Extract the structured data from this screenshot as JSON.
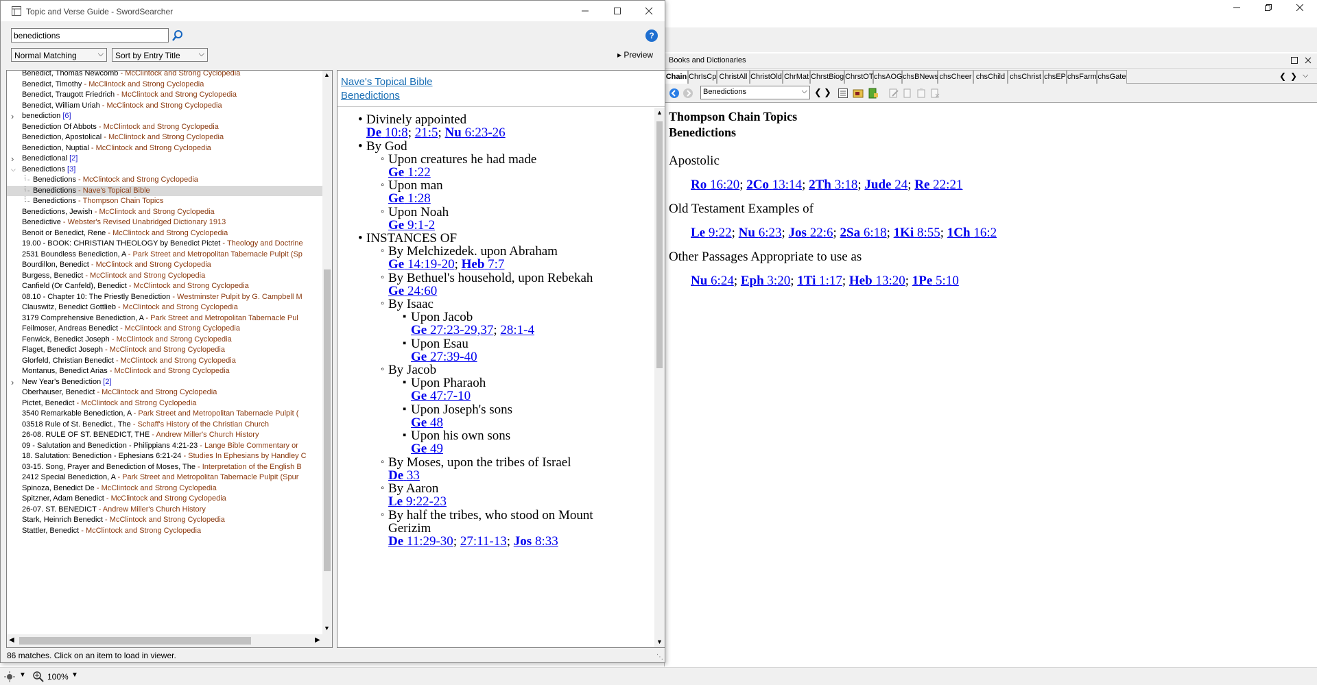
{
  "main_window": {
    "minimize_label": "Minimize",
    "maximize_label": "Restore",
    "close_label": "Close"
  },
  "books": {
    "title": "Books and Dictionaries",
    "tabs": [
      "Chain",
      "ChrIsCp",
      "ChristAll",
      "ChristOld",
      "ChrMat",
      "ChrstBiog",
      "ChrstOT",
      "chsAOG",
      "chsBNews",
      "chsCheer",
      "chsChild",
      "chsChrist",
      "chsEP",
      "chsFarm",
      "chsGate"
    ],
    "active_tab": "Chain",
    "topic_select": "Benedictions",
    "heading1": "Thompson Chain Topics",
    "heading2": "Benedictions",
    "sections": [
      {
        "label": "Apostolic",
        "refs": [
          {
            "b": "Ro",
            "r": "16:20"
          },
          {
            "b": "2Co",
            "r": "13:14"
          },
          {
            "b": "2Th",
            "r": "3:18"
          },
          {
            "b": "Jude",
            "r": "24"
          },
          {
            "b": "Re",
            "r": "22:21"
          }
        ]
      },
      {
        "label": "Old Testament Examples of",
        "refs": [
          {
            "b": "Le",
            "r": "9:22"
          },
          {
            "b": "Nu",
            "r": "6:23"
          },
          {
            "b": "Jos",
            "r": "22:6"
          },
          {
            "b": "2Sa",
            "r": "6:18"
          },
          {
            "b": "1Ki",
            "r": "8:55"
          },
          {
            "b": "1Ch",
            "r": "16:2"
          }
        ]
      },
      {
        "label": "Other Passages Appropriate to use as",
        "refs": [
          {
            "b": "Nu",
            "r": "6:24"
          },
          {
            "b": "Eph",
            "r": "3:20"
          },
          {
            "b": "1Ti",
            "r": "1:17"
          },
          {
            "b": "Heb",
            "r": "13:20"
          },
          {
            "b": "1Pe",
            "r": "5:10"
          }
        ]
      }
    ]
  },
  "dialog": {
    "title": "Topic and Verse Guide - SwordSearcher",
    "search_value": "benedictions",
    "match_mode": "Normal Matching",
    "sort_mode": "Sort by Entry Title",
    "preview_label": "▸ Preview",
    "help_label": "?",
    "status": "86 matches. Click on an item to load in viewer."
  },
  "list": [
    {
      "t": "Benedict, Thomas Newcomb",
      "s": " - McClintock and Strong Cyclopedia",
      "ind": 1
    },
    {
      "t": "Benedict, Timothy",
      "s": " - McClintock and Strong Cyclopedia",
      "ind": 1
    },
    {
      "t": "Benedict, Traugott Friedrich",
      "s": " - McClintock and Strong Cyclopedia",
      "ind": 1
    },
    {
      "t": "Benedict, William Uriah",
      "s": " - McClintock and Strong Cyclopedia",
      "ind": 1
    },
    {
      "t": "benediction",
      "c": " [6]",
      "ind": 1,
      "exp": "closed"
    },
    {
      "t": "Benediction Of Abbots",
      "s": " - McClintock and Strong Cyclopedia",
      "ind": 1
    },
    {
      "t": "Benediction, Apostolical",
      "s": " - McClintock and Strong Cyclopedia",
      "ind": 1
    },
    {
      "t": "Benediction, Nuptial",
      "s": " - McClintock and Strong Cyclopedia",
      "ind": 1
    },
    {
      "t": "Benedictional",
      "c": " [2]",
      "ind": 1,
      "exp": "closed"
    },
    {
      "t": "Benedictions",
      "c": " [3]",
      "ind": 1,
      "exp": "open"
    },
    {
      "t": "Benedictions",
      "s": " - McClintock and Strong Cyclopedia",
      "ind": 2
    },
    {
      "t": "Benedictions",
      "s": " - Nave's Topical Bible",
      "ind": 2,
      "sel": true
    },
    {
      "t": "Benedictions",
      "s": " - Thompson Chain Topics",
      "ind": 2
    },
    {
      "t": "Benedictions, Jewish",
      "s": " - McClintock and Strong Cyclopedia",
      "ind": 1
    },
    {
      "t": "Benedictive",
      "s": " - Webster's Revised Unabridged Dictionary 1913",
      "ind": 1
    },
    {
      "t": "Benoit or Benedict, Rene",
      "s": " - McClintock and Strong Cyclopedia",
      "ind": 1
    },
    {
      "t": "19.00 - BOOK: CHRISTIAN THEOLOGY by Benedict Pictet",
      "s": " - Theology and Doctrine",
      "ind": 1
    },
    {
      "t": "2531 Boundless Benediction, A",
      "s": " - Park Street and Metropolitan Tabernacle Pulpit (Sp",
      "ind": 1
    },
    {
      "t": "Bourdillon, Benedict",
      "s": " - McClintock and Strong Cyclopedia",
      "ind": 1
    },
    {
      "t": "Burgess, Benedict",
      "s": " - McClintock and Strong Cyclopedia",
      "ind": 1
    },
    {
      "t": "Canfield (Or Canfeld), Benedict",
      "s": " - McClintock and Strong Cyclopedia",
      "ind": 1
    },
    {
      "t": "08.10 - Chapter 10: The Priestly Benediction",
      "s": " - Westminster Pulpit by  G. Campbell M",
      "ind": 1
    },
    {
      "t": "Clauswitz, Benedict Gottlieb",
      "s": " - McClintock and Strong Cyclopedia",
      "ind": 1
    },
    {
      "t": "3179 Comprehensive Benediction, A",
      "s": " - Park Street and Metropolitan Tabernacle Pul",
      "ind": 1
    },
    {
      "t": "Feilmoser, Andreas Benedict",
      "s": " - McClintock and Strong Cyclopedia",
      "ind": 1
    },
    {
      "t": "Fenwick, Benedict Joseph",
      "s": " - McClintock and Strong Cyclopedia",
      "ind": 1
    },
    {
      "t": "Flaget, Benedict Joseph",
      "s": " - McClintock and Strong Cyclopedia",
      "ind": 1
    },
    {
      "t": "Glorfeld, Christian Benedict",
      "s": " - McClintock and Strong Cyclopedia",
      "ind": 1
    },
    {
      "t": "Montanus, Benedict Arias",
      "s": " - McClintock and Strong Cyclopedia",
      "ind": 1
    },
    {
      "t": "New Year's Benediction",
      "c": " [2]",
      "ind": 1,
      "exp": "closed"
    },
    {
      "t": "Oberhauser, Benedict",
      "s": " - McClintock and Strong Cyclopedia",
      "ind": 1
    },
    {
      "t": "Pictet, Benedict",
      "s": " - McClintock and Strong Cyclopedia",
      "ind": 1
    },
    {
      "t": "3540 Remarkable Benediction, A",
      "s": " - Park Street and Metropolitan Tabernacle Pulpit (",
      "ind": 1
    },
    {
      "t": "03518  Rule of St.  Benedict., The",
      "s": " - Schaff's History of the Christian Church",
      "ind": 1
    },
    {
      "t": "26-08. RULE OF ST. BENEDICT, THE",
      "s": " - Andrew Miller's Church History",
      "ind": 1
    },
    {
      "t": "09 - Salutation and Benediction - Philippians 4:21-23",
      "s": " - Lange Bible Commentary or",
      "ind": 1
    },
    {
      "t": "18. Salutation: Benediction - Ephesians 6:21-24",
      "s": " - Studies In Ephesians by Handley C",
      "ind": 1
    },
    {
      "t": "03-15. Song, Prayer and Benediction of Moses, The",
      "s": " - Interpretation of the English B",
      "ind": 1
    },
    {
      "t": "2412 Special Benediction, A",
      "s": " - Park Street and Metropolitan Tabernacle Pulpit (Spur",
      "ind": 1
    },
    {
      "t": "Spinoza, Benedict De",
      "s": " - McClintock and Strong Cyclopedia",
      "ind": 1
    },
    {
      "t": "Spitzner, Adam Benedict",
      "s": " - McClintock and Strong Cyclopedia",
      "ind": 1
    },
    {
      "t": "26-07. ST. BENEDICT",
      "s": " - Andrew Miller's Church History",
      "ind": 1
    },
    {
      "t": "Stark, Heinrich Benedict",
      "s": " - McClintock and Strong Cyclopedia",
      "ind": 1
    },
    {
      "t": "Stattler, Benedict",
      "s": " - McClintock and Strong Cyclopedia",
      "ind": 1
    }
  ],
  "viewer": {
    "link1": "Nave's Topical Bible",
    "link2": "Benedictions",
    "items": [
      {
        "lvl": 1,
        "text": "Divinely appointed"
      },
      {
        "lvl": 1,
        "refs": [
          {
            "b": "De",
            "r": "10:8"
          },
          {
            "r": "21:5"
          },
          {
            "b": "Nu",
            "r": "6:23-26"
          }
        ]
      },
      {
        "lvl": 1,
        "text": "By God"
      },
      {
        "lvl": 2,
        "text": "Upon creatures he had made"
      },
      {
        "lvl": 2,
        "refs": [
          {
            "b": "Ge",
            "r": "1:22"
          }
        ]
      },
      {
        "lvl": 2,
        "text": "Upon man"
      },
      {
        "lvl": 2,
        "refs": [
          {
            "b": "Ge",
            "r": "1:28"
          }
        ]
      },
      {
        "lvl": 2,
        "text": "Upon Noah"
      },
      {
        "lvl": 2,
        "refs": [
          {
            "b": "Ge",
            "r": "9:1-2"
          }
        ]
      },
      {
        "lvl": 1,
        "text": "INSTANCES OF"
      },
      {
        "lvl": 2,
        "text": "By Melchizedek. upon Abraham"
      },
      {
        "lvl": 2,
        "refs": [
          {
            "b": "Ge",
            "r": "14:19-20"
          },
          {
            "b": "Heb",
            "r": "7:7"
          }
        ]
      },
      {
        "lvl": 2,
        "text": "By Bethuel's household, upon Rebekah"
      },
      {
        "lvl": 2,
        "refs": [
          {
            "b": "Ge",
            "r": "24:60"
          }
        ]
      },
      {
        "lvl": 2,
        "text": "By Isaac"
      },
      {
        "lvl": 3,
        "text": "Upon Jacob"
      },
      {
        "lvl": 3,
        "refs": [
          {
            "b": "Ge",
            "r": "27:23-29,37"
          },
          {
            "r": "28:1-4"
          }
        ]
      },
      {
        "lvl": 3,
        "text": "Upon Esau"
      },
      {
        "lvl": 3,
        "refs": [
          {
            "b": "Ge",
            "r": "27:39-40"
          }
        ]
      },
      {
        "lvl": 2,
        "text": "By Jacob"
      },
      {
        "lvl": 3,
        "text": "Upon Pharaoh"
      },
      {
        "lvl": 3,
        "refs": [
          {
            "b": "Ge",
            "r": "47:7-10"
          }
        ]
      },
      {
        "lvl": 3,
        "text": "Upon Joseph's sons"
      },
      {
        "lvl": 3,
        "refs": [
          {
            "b": "Ge",
            "r": "48"
          }
        ]
      },
      {
        "lvl": 3,
        "text": "Upon his own sons"
      },
      {
        "lvl": 3,
        "refs": [
          {
            "b": "Ge",
            "r": "49"
          }
        ]
      },
      {
        "lvl": 2,
        "text": "By Moses, upon the tribes of Israel"
      },
      {
        "lvl": 2,
        "refs": [
          {
            "b": "De",
            "r": "33"
          }
        ]
      },
      {
        "lvl": 2,
        "text": "By Aaron"
      },
      {
        "lvl": 2,
        "refs": [
          {
            "b": "Le",
            "r": "9:22-23"
          }
        ]
      },
      {
        "lvl": 2,
        "text": "By half the tribes, who stood on Mount"
      },
      {
        "lvl": 2,
        "text": "Gerizim",
        "cont": true
      },
      {
        "lvl": 2,
        "refs": [
          {
            "b": "De",
            "r": "11:29-30"
          },
          {
            "r": "27:11-13"
          },
          {
            "b": "Jos",
            "r": "8:33"
          }
        ]
      }
    ]
  },
  "bottom": {
    "zoom": "100%"
  },
  "colors": {
    "source": "#8b3a0f",
    "count": "#1a1ad0",
    "link": "#0000ee",
    "selected": "#d9d9d9"
  }
}
